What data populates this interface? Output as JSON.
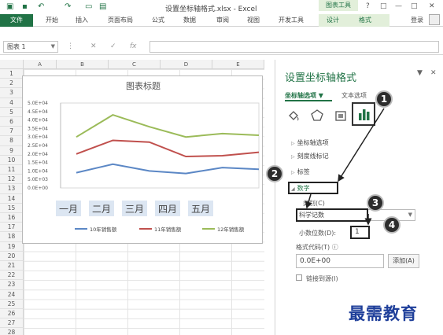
{
  "title": {
    "document": "设置坐标轴格式.xlsx - Excel",
    "context_tools": "图表工具",
    "window_buttons": [
      "?",
      "□",
      "—",
      "□",
      "✕"
    ]
  },
  "ribbon": {
    "file": "文件",
    "tabs": [
      "开始",
      "插入",
      "页面布局",
      "公式",
      "数据",
      "审阅",
      "视图",
      "开发工具"
    ],
    "context_tabs": [
      "设计",
      "格式"
    ],
    "login": "登录"
  },
  "formula_bar": {
    "name_box": "图表 1",
    "cancel": "✕",
    "confirm": "✓",
    "fx": "fx"
  },
  "sheet": {
    "columns": [
      "A",
      "B",
      "C",
      "D",
      "E"
    ],
    "rows": [
      "1",
      "2",
      "3",
      "4",
      "5",
      "6",
      "7",
      "8",
      "9",
      "10",
      "11",
      "12",
      "13",
      "14",
      "15",
      "16",
      "17",
      "18",
      "19",
      "20",
      "21",
      "22",
      "23",
      "24",
      "25",
      "26",
      "27",
      "28"
    ]
  },
  "chart_data": {
    "type": "line",
    "title": "图表标题",
    "categories": [
      "一月",
      "二月",
      "三月",
      "四月",
      "五月"
    ],
    "ytick_labels": [
      "5.0E+04",
      "4.5E+04",
      "4.0E+04",
      "3.5E+04",
      "3.0E+04",
      "2.5E+04",
      "2.0E+04",
      "1.5E+04",
      "1.0E+04",
      "5.0E+03",
      "0.0E+00"
    ],
    "ylim": [
      0,
      50000
    ],
    "series": [
      {
        "name": "10年销售额",
        "color": "#5b87c5",
        "values": [
          9000,
          14000,
          10000,
          8500,
          12000,
          11000
        ]
      },
      {
        "name": "11年销售额",
        "color": "#c0504d",
        "values": [
          20000,
          28000,
          27000,
          18500,
          19000,
          21000
        ]
      },
      {
        "name": "12年销售额",
        "color": "#9bbb59",
        "values": [
          30000,
          43000,
          36000,
          30000,
          32000,
          31000
        ]
      }
    ],
    "legend_position": "bottom"
  },
  "pane": {
    "title": "设置坐标轴格式",
    "tab_axis_options": "坐标轴选项",
    "tab_text_options": "文本选项",
    "sections": [
      "坐标轴选项",
      "刻度线标记",
      "标签",
      "数字"
    ],
    "category_label": "类别(C)",
    "category_value": "科学记数",
    "decimal_label": "小数位数(D):",
    "decimal_value": "1",
    "format_code_label": "格式代码(T)",
    "format_code_value": "0.0E+00",
    "add_button": "添加(A)",
    "link_source": "链接到源(I)",
    "info": "ⓘ"
  },
  "badges": [
    "1",
    "2",
    "3",
    "4"
  ],
  "watermark": "最需教育"
}
